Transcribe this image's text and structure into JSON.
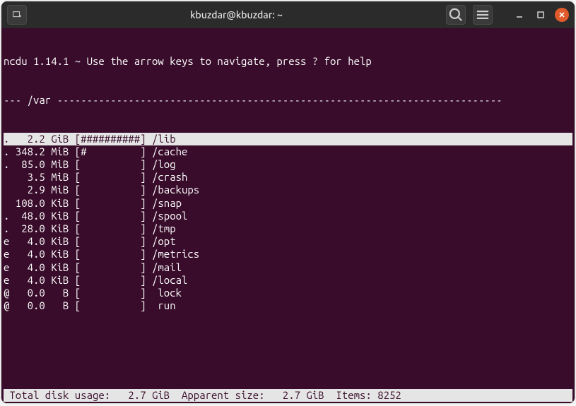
{
  "window": {
    "title": "kbuzdar@kbuzdar: ~"
  },
  "ncdu": {
    "header": "ncdu 1.14.1 ~ Use the arrow keys to navigate, press ? for help",
    "path_prefix": "--- ",
    "path": "/var",
    "path_suffix": " ---------------------------------------------------------------------------",
    "rows": [
      {
        "flag": ".",
        "size": "   2.2 GiB",
        "bar": "[##########]",
        "name": " /lib",
        "selected": true
      },
      {
        "flag": ".",
        "size": " 348.2 MiB",
        "bar": "[#         ]",
        "name": " /cache",
        "selected": false
      },
      {
        "flag": ".",
        "size": "  85.0 MiB",
        "bar": "[          ]",
        "name": " /log",
        "selected": false
      },
      {
        "flag": " ",
        "size": "   3.5 MiB",
        "bar": "[          ]",
        "name": " /crash",
        "selected": false
      },
      {
        "flag": " ",
        "size": "   2.9 MiB",
        "bar": "[          ]",
        "name": " /backups",
        "selected": false
      },
      {
        "flag": " ",
        "size": " 108.0 KiB",
        "bar": "[          ]",
        "name": " /snap",
        "selected": false
      },
      {
        "flag": ".",
        "size": "  48.0 KiB",
        "bar": "[          ]",
        "name": " /spool",
        "selected": false
      },
      {
        "flag": ".",
        "size": "  28.0 KiB",
        "bar": "[          ]",
        "name": " /tmp",
        "selected": false
      },
      {
        "flag": "e",
        "size": "   4.0 KiB",
        "bar": "[          ]",
        "name": " /opt",
        "selected": false
      },
      {
        "flag": "e",
        "size": "   4.0 KiB",
        "bar": "[          ]",
        "name": " /metrics",
        "selected": false
      },
      {
        "flag": "e",
        "size": "   4.0 KiB",
        "bar": "[          ]",
        "name": " /mail",
        "selected": false
      },
      {
        "flag": "e",
        "size": "   4.0 KiB",
        "bar": "[          ]",
        "name": " /local",
        "selected": false
      },
      {
        "flag": "@",
        "size": "   0.0   B",
        "bar": "[          ]",
        "name": "  lock",
        "selected": false
      },
      {
        "flag": "@",
        "size": "   0.0   B",
        "bar": "[          ]",
        "name": "  run",
        "selected": false
      }
    ],
    "status": " Total disk usage:   2.7 GiB  Apparent size:   2.7 GiB  Items: 8252"
  }
}
